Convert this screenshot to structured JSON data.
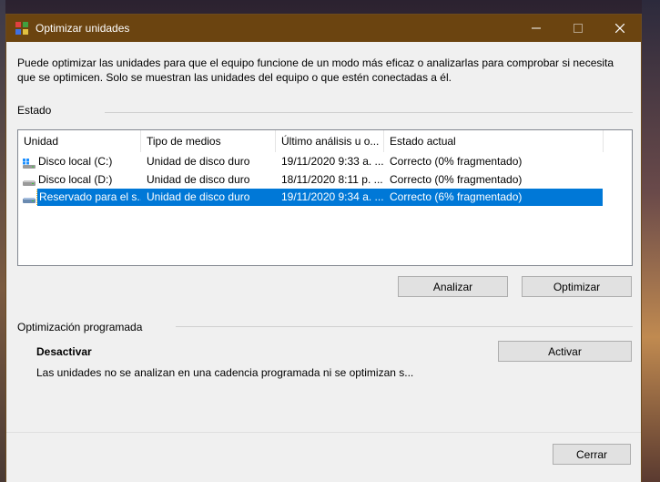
{
  "window": {
    "title": "Optimizar unidades"
  },
  "description": "Puede optimizar las unidades para que el equipo funcione de un modo más eficaz o analizarlas para comprobar si necesita que se optimicen. Solo se muestran las unidades del equipo o que estén conectadas a él.",
  "status": {
    "label": "Estado",
    "columns": [
      "Unidad",
      "Tipo de medios",
      "Último análisis u o...",
      "Estado actual"
    ],
    "rows": [
      {
        "drive": "Disco local (C:)",
        "media": "Unidad de disco duro",
        "last": "19/11/2020 9:33 a. ...",
        "state": "Correcto (0% fragmentado)",
        "icon": "windows-drive-icon",
        "selected": false
      },
      {
        "drive": "Disco local (D:)",
        "media": "Unidad de disco duro",
        "last": "18/11/2020 8:11 p. ...",
        "state": "Correcto (0% fragmentado)",
        "icon": "hard-drive-icon",
        "selected": false
      },
      {
        "drive": "Reservado para el s...",
        "media": "Unidad de disco duro",
        "last": "19/11/2020 9:34 a. ...",
        "state": "Correcto (6% fragmentado)",
        "icon": "hard-drive-icon",
        "selected": true
      }
    ],
    "analyze_label": "Analizar",
    "optimize_label": "Optimizar"
  },
  "scheduled": {
    "label": "Optimización programada",
    "state": "Desactivar",
    "details": "Las unidades no se analizan en una cadencia programada ni se optimizan s...",
    "activate_label": "Activar"
  },
  "footer": {
    "close_label": "Cerrar"
  },
  "colors": {
    "titlebar": "#6b4410",
    "selection": "#0078d7"
  }
}
